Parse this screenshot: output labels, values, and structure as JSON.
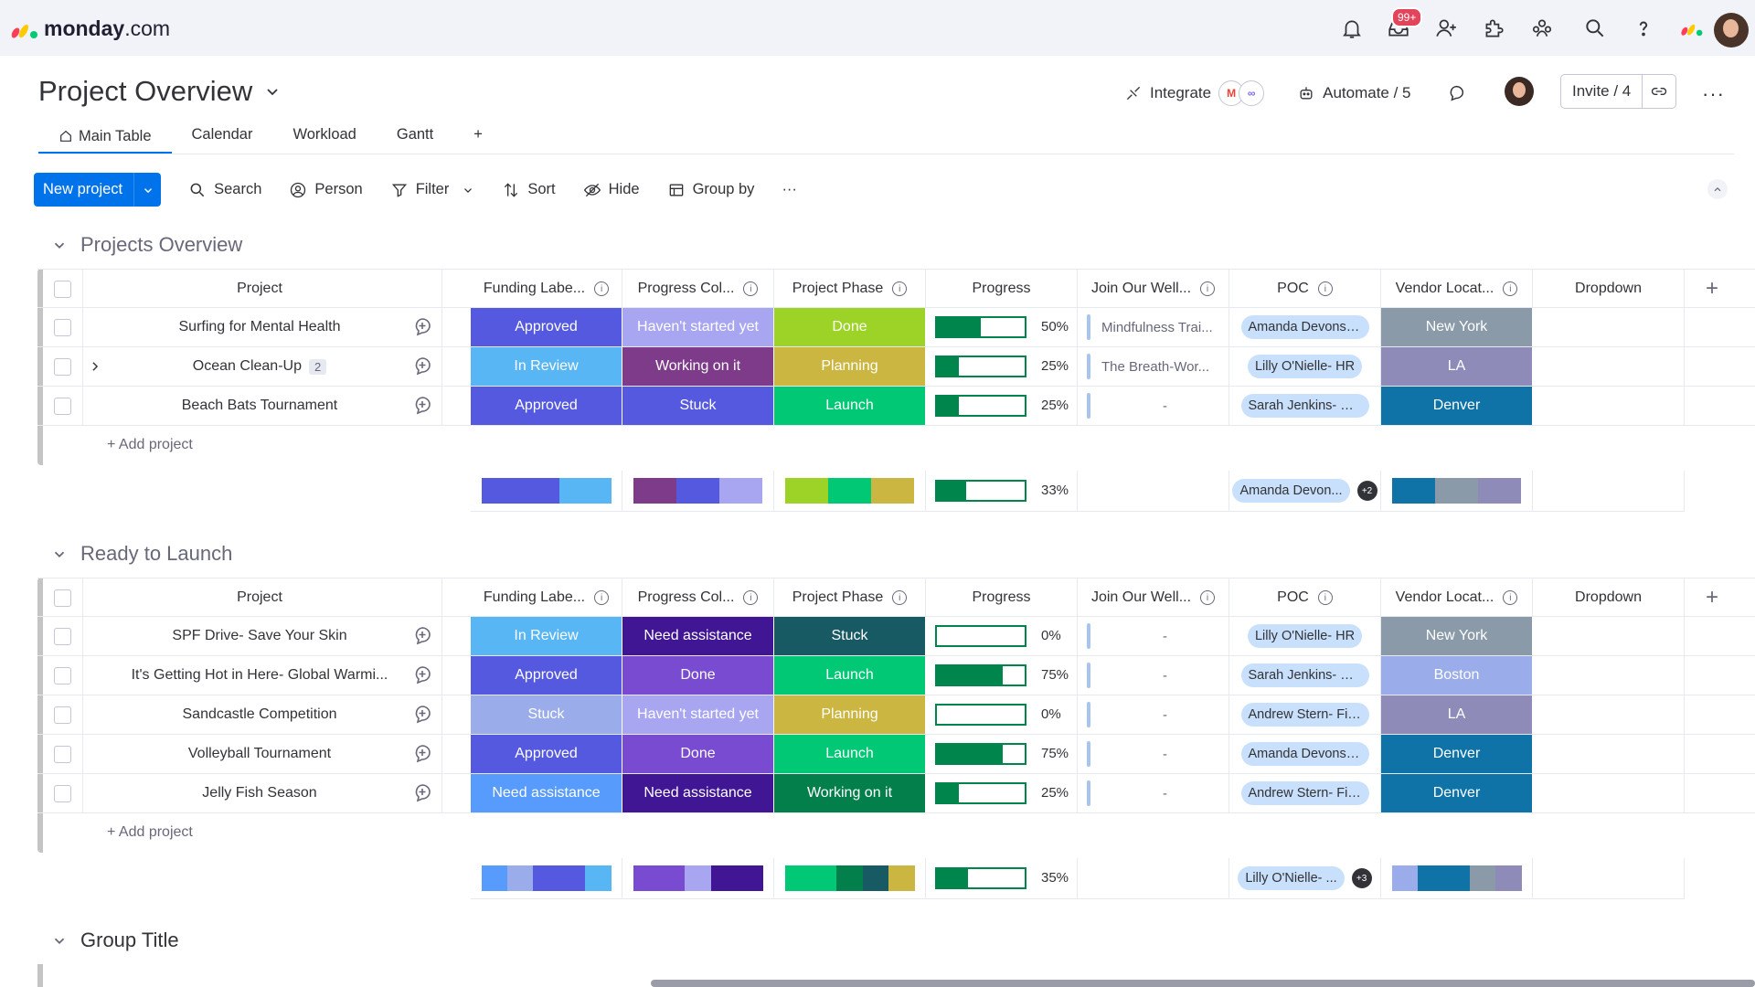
{
  "app": {
    "brand": "monday",
    "brand_suffix": ".com",
    "notif_count": "99+"
  },
  "board": {
    "title": "Project Overview"
  },
  "header": {
    "integrate": "Integrate",
    "automate": "Automate / 5",
    "invite": "Invite / 4"
  },
  "tabs": [
    "Main Table",
    "Calendar",
    "Workload",
    "Gantt",
    "+"
  ],
  "toolbar": {
    "new_project": "New project",
    "search": "Search",
    "person": "Person",
    "filter": "Filter",
    "sort": "Sort",
    "hide": "Hide",
    "group_by": "Group by",
    "more": "···"
  },
  "columns": {
    "project": "Project",
    "funding": "Funding Labe...",
    "progress_col": "Progress Col...",
    "phase": "Project Phase",
    "progress": "Progress",
    "wellness": "Join Our Well...",
    "poc": "POC",
    "vendor": "Vendor Locat...",
    "dropdown": "Dropdown"
  },
  "colors": {
    "approved": "#5559df",
    "in_review": "#579bfc",
    "stuck_light": "#9aadea",
    "need_assist_blue": "#579bfc",
    "havent": "#a9a6f1",
    "working": "#7e3b8a",
    "stuck_purple": "#5559df",
    "need_assist_dark": "#401694",
    "done_purple": "#784bd1",
    "done_green": "#9cd326",
    "planning": "#cab641",
    "launch": "#00c875",
    "stuck_teal": "#175a63",
    "working_green": "#037f4c",
    "ny": "#8a9aa8",
    "la": "#8e8bb8",
    "denver": "#0f73a8",
    "boston": "#9aadea"
  },
  "groups": [
    {
      "title": "Projects Overview",
      "rows": [
        {
          "name": "Surfing for Mental Health",
          "sub": "",
          "funding": "Approved",
          "funding_color": "#5559df",
          "pcol": "Haven't started yet",
          "pcol_color": "#a9a6f1",
          "phase": "Done",
          "phase_color": "#9cd326",
          "progress": 50,
          "progress_label": "50%",
          "wellness": "Mindfulness Trai...",
          "poc": "Amanda Devons- ...",
          "vendor": "New York",
          "vendor_color": "#8a9aa8"
        },
        {
          "name": "Ocean Clean-Up",
          "sub": "2",
          "funding": "In Review",
          "funding_color": "#58b6f5",
          "pcol": "Working on it",
          "pcol_color": "#7e3b8a",
          "phase": "Planning",
          "phase_color": "#cab641",
          "progress": 25,
          "progress_label": "25%",
          "wellness": "The Breath-Wor...",
          "poc": "Lilly O'Nielle- HR",
          "vendor": "LA",
          "vendor_color": "#8e8bb8"
        },
        {
          "name": "Beach Bats Tournament",
          "sub": "",
          "funding": "Approved",
          "funding_color": "#5559df",
          "pcol": "Stuck",
          "pcol_color": "#5559df",
          "phase": "Launch",
          "phase_color": "#00c875",
          "progress": 25,
          "progress_label": "25%",
          "wellness": "-",
          "poc": "Sarah Jenkins- Ma...",
          "vendor": "Denver",
          "vendor_color": "#0f73a8"
        }
      ],
      "add": "+ Add project",
      "summary": {
        "progress": 33,
        "progress_label": "33%",
        "poc": "Amanda Devon...",
        "poc_more": "+2",
        "funding_segments": [
          {
            "color": "#5559df",
            "weight": 3
          },
          {
            "color": "#58b6f5",
            "weight": 2
          }
        ],
        "pcol_segments": [
          {
            "color": "#7e3b8a",
            "weight": 1
          },
          {
            "color": "#5559df",
            "weight": 1
          },
          {
            "color": "#a9a6f1",
            "weight": 1
          }
        ],
        "phase_segments": [
          {
            "color": "#9cd326",
            "weight": 1
          },
          {
            "color": "#00c875",
            "weight": 1
          },
          {
            "color": "#cab641",
            "weight": 1
          }
        ],
        "vendor_segments": [
          {
            "color": "#0f73a8",
            "weight": 1
          },
          {
            "color": "#8a9aa8",
            "weight": 1
          },
          {
            "color": "#8e8bb8",
            "weight": 1
          }
        ]
      }
    },
    {
      "title": "Ready to Launch",
      "rows": [
        {
          "name": "SPF Drive- Save Your Skin",
          "sub": "",
          "funding": "In Review",
          "funding_color": "#58b6f5",
          "pcol": "Need assistance",
          "pcol_color": "#401694",
          "phase": "Stuck",
          "phase_color": "#175a63",
          "progress": 0,
          "progress_label": "0%",
          "wellness": "-",
          "poc": "Lilly O'Nielle- HR",
          "vendor": "New York",
          "vendor_color": "#8a9aa8"
        },
        {
          "name": "It's Getting Hot in Here- Global Warmi...",
          "sub": "",
          "funding": "Approved",
          "funding_color": "#5559df",
          "pcol": "Done",
          "pcol_color": "#784bd1",
          "phase": "Launch",
          "phase_color": "#00c875",
          "progress": 75,
          "progress_label": "75%",
          "wellness": "-",
          "poc": "Sarah Jenkins- Ma...",
          "vendor": "Boston",
          "vendor_color": "#9aadea"
        },
        {
          "name": "Sandcastle Competition",
          "sub": "",
          "funding": "Stuck",
          "funding_color": "#9aadea",
          "pcol": "Haven't started yet",
          "pcol_color": "#a9a6f1",
          "phase": "Planning",
          "phase_color": "#cab641",
          "progress": 0,
          "progress_label": "0%",
          "wellness": "-",
          "poc": "Andrew Stern- Fin...",
          "vendor": "LA",
          "vendor_color": "#8e8bb8"
        },
        {
          "name": "Volleyball Tournament",
          "sub": "",
          "funding": "Approved",
          "funding_color": "#5559df",
          "pcol": "Done",
          "pcol_color": "#784bd1",
          "phase": "Launch",
          "phase_color": "#00c875",
          "progress": 75,
          "progress_label": "75%",
          "wellness": "-",
          "poc": "Amanda Devons- ...",
          "vendor": "Denver",
          "vendor_color": "#0f73a8"
        },
        {
          "name": "Jelly Fish Season",
          "sub": "",
          "funding": "Need assistance",
          "funding_color": "#579bfc",
          "pcol": "Need assistance",
          "pcol_color": "#401694",
          "phase": "Working on it",
          "phase_color": "#037f4c",
          "progress": 25,
          "progress_label": "25%",
          "wellness": "-",
          "poc": "Andrew Stern- Fin...",
          "vendor": "Denver",
          "vendor_color": "#0f73a8"
        }
      ],
      "add": "+ Add project",
      "summary": {
        "progress": 35,
        "progress_label": "35%",
        "poc": "Lilly O'Nielle- ...",
        "poc_more": "+3",
        "funding_segments": [
          {
            "color": "#579bfc",
            "weight": 1
          },
          {
            "color": "#9aadea",
            "weight": 1
          },
          {
            "color": "#5559df",
            "weight": 2
          },
          {
            "color": "#58b6f5",
            "weight": 1
          }
        ],
        "pcol_segments": [
          {
            "color": "#784bd1",
            "weight": 2
          },
          {
            "color": "#a9a6f1",
            "weight": 1
          },
          {
            "color": "#401694",
            "weight": 2
          }
        ],
        "phase_segments": [
          {
            "color": "#00c875",
            "weight": 2
          },
          {
            "color": "#037f4c",
            "weight": 1
          },
          {
            "color": "#175a63",
            "weight": 1
          },
          {
            "color": "#cab641",
            "weight": 1
          }
        ],
        "vendor_segments": [
          {
            "color": "#9aadea",
            "weight": 1
          },
          {
            "color": "#0f73a8",
            "weight": 2
          },
          {
            "color": "#8a9aa8",
            "weight": 1
          },
          {
            "color": "#8e8bb8",
            "weight": 1
          }
        ]
      }
    }
  ],
  "group3": {
    "title": "Group Title"
  }
}
